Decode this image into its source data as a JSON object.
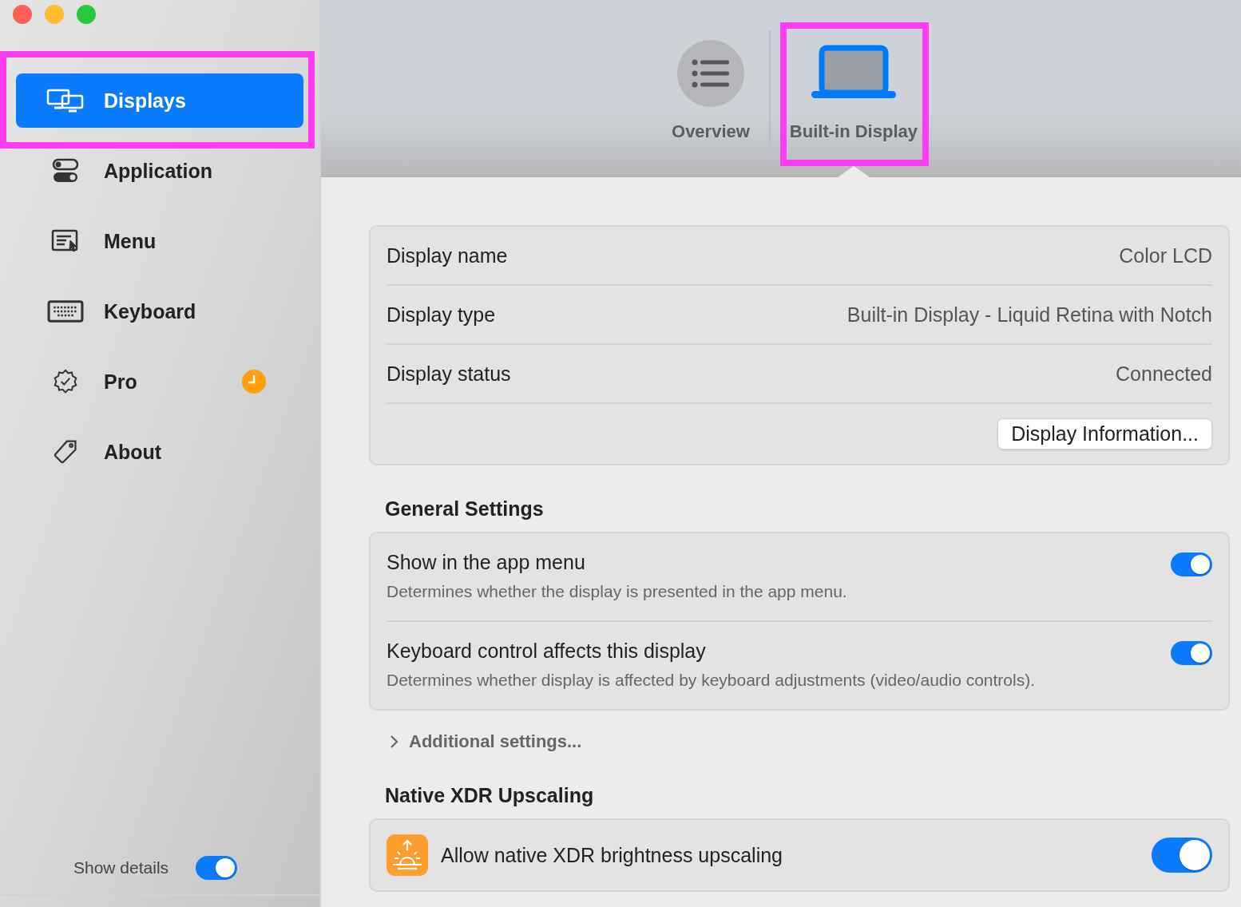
{
  "sidebar": {
    "items": [
      {
        "label": "Displays",
        "selected": true,
        "highlighted": true,
        "badge": false
      },
      {
        "label": "Application",
        "selected": false,
        "highlighted": false,
        "badge": false
      },
      {
        "label": "Menu",
        "selected": false,
        "highlighted": false,
        "badge": false
      },
      {
        "label": "Keyboard",
        "selected": false,
        "highlighted": false,
        "badge": false
      },
      {
        "label": "Pro",
        "selected": false,
        "highlighted": false,
        "badge": true
      },
      {
        "label": "About",
        "selected": false,
        "highlighted": false,
        "badge": false
      }
    ],
    "show_details": {
      "label": "Show details",
      "on": true
    }
  },
  "tabs": [
    {
      "label": "Overview",
      "selected": false,
      "highlighted": false
    },
    {
      "label": "Built-in Display",
      "selected": true,
      "highlighted": true
    }
  ],
  "info": {
    "rows": [
      {
        "label": "Display name",
        "value": "Color LCD"
      },
      {
        "label": "Display type",
        "value": "Built-in Display - Liquid Retina with Notch"
      },
      {
        "label": "Display status",
        "value": "Connected"
      }
    ],
    "button": "Display Information..."
  },
  "general": {
    "title": "General Settings",
    "settings": [
      {
        "label": "Show in the app menu",
        "description": "Determines whether the display is presented in the app menu.",
        "on": true
      },
      {
        "label": "Keyboard control affects this display",
        "description": "Determines whether display is affected by keyboard adjustments (video/audio controls).",
        "on": true
      }
    ]
  },
  "additional": {
    "label": "Additional settings...",
    "expanded": false
  },
  "xdr": {
    "title": "Native XDR Upscaling",
    "settings": [
      {
        "label": "Allow native XDR brightness upscaling",
        "on": true
      }
    ]
  }
}
